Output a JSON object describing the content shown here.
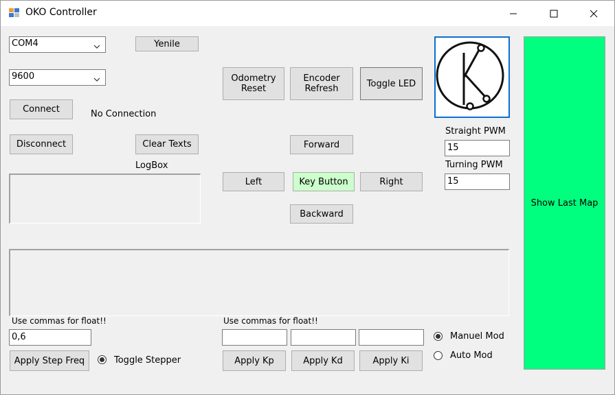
{
  "window": {
    "title": "OKO Controller",
    "minimize_label": "—",
    "maximize_label": "☐",
    "close_label": "✕"
  },
  "connection": {
    "port_value": "COM4",
    "baud_value": "9600",
    "refresh_label": "Yenile",
    "connect_label": "Connect",
    "status_text": "No Connection",
    "disconnect_label": "Disconnect",
    "clear_texts_label": "Clear Texts",
    "logbox_label": "LogBox"
  },
  "controls": {
    "odometry_reset_label": "Odometry Reset",
    "encoder_refresh_label": "Encoder Refresh",
    "toggle_led_label": "Toggle LED",
    "forward_label": "Forward",
    "left_label": "Left",
    "key_button_label": "Key Button",
    "right_label": "Right",
    "backward_label": "Backward"
  },
  "pwm": {
    "straight_label": "Straight PWM",
    "straight_value": "15",
    "turning_label": "Turning PWM",
    "turning_value": "15"
  },
  "map": {
    "show_last_map_label": "Show Last Map",
    "color": "#00ff7f"
  },
  "stepper": {
    "hint": "Use commas for float!!",
    "freq_value": "0,6",
    "apply_label": "Apply Step Freq",
    "toggle_label": "Toggle Stepper",
    "toggle_checked": true
  },
  "pid": {
    "hint": "Use commas for float!!",
    "kp_value": "",
    "kd_value": "",
    "ki_value": "",
    "apply_kp_label": "Apply Kp",
    "apply_kd_label": "Apply Kd",
    "apply_ki_label": "Apply Ki"
  },
  "mode": {
    "manual_label": "Manuel Mod",
    "auto_label": "Auto Mod",
    "selected": "manual"
  },
  "icons": {
    "logo": "oko-k-logo-icon",
    "app": "app-window-icon",
    "dropdown": "chevron-down-icon"
  }
}
